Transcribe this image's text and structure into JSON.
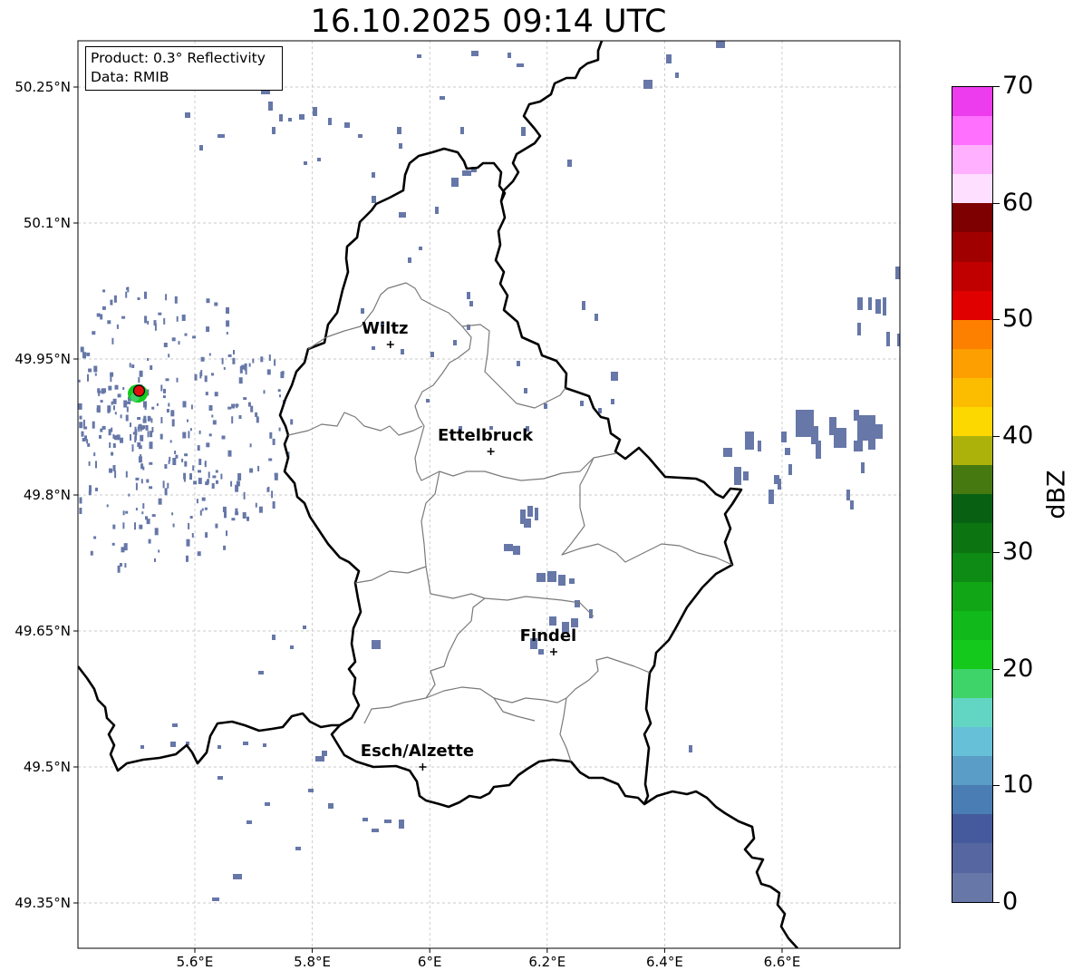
{
  "title": "16.10.2025 09:14 UTC",
  "info_box": {
    "line1": "Product: 0.3° Reflectivity",
    "line2": "Data: RMIB"
  },
  "lat_labels": [
    "50.25°N",
    "50.1°N",
    "49.95°N",
    "49.8°N",
    "49.65°N",
    "49.5°N",
    "49.35°N"
  ],
  "lon_labels": [
    "5.6°E",
    "5.8°E",
    "6°E",
    "6.2°E",
    "6.4°E",
    "6.6°E"
  ],
  "cities": [
    {
      "name": "Wiltz",
      "lon": 5.933,
      "lat": 49.966
    },
    {
      "name": "Ettelbruck",
      "lon": 6.104,
      "lat": 49.848
    },
    {
      "name": "Findel",
      "lon": 6.211,
      "lat": 49.627
    },
    {
      "name": "Esch/Alzette",
      "lon": 5.988,
      "lat": 49.5
    }
  ],
  "radar_site": {
    "lon": 5.505,
    "lat": 49.915
  },
  "colorbar": {
    "unit": "dBZ",
    "tick_labels": [
      "0",
      "10",
      "20",
      "30",
      "40",
      "50",
      "60",
      "70"
    ],
    "colors": [
      "#6677a8",
      "#5566a0",
      "#445a9c",
      "#4a7db3",
      "#5a9dc6",
      "#66c0d8",
      "#63d6c3",
      "#3fd46a",
      "#15c91c",
      "#12b91a",
      "#10a616",
      "#0e8b14",
      "#0c7512",
      "#086012",
      "#467a10",
      "#acb20a",
      "#fdd700",
      "#fcbc00",
      "#fd9f00",
      "#fe8000",
      "#e00000",
      "#c00000",
      "#a00000",
      "#7e0000",
      "#ffdfff",
      "#ffb0ff",
      "#ff70ff",
      "#ec3ced"
    ]
  }
}
